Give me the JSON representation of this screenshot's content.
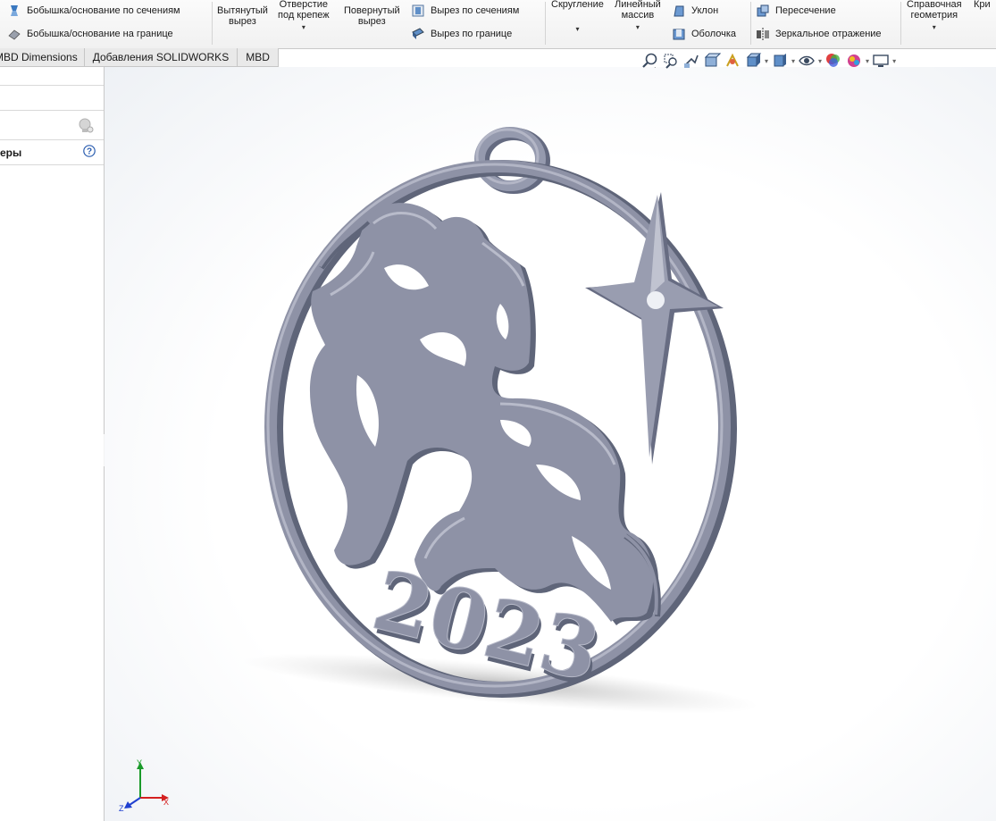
{
  "ribbon": {
    "boss_sections_label": "Бобышка/основание по сечениям",
    "boss_boundary_label": "Бобышка/основание на границе",
    "extruded_cut_label": "Вытянутый\nвырез",
    "hole_wizard_label": "Отверстие\nпод крепеж",
    "revolved_cut_label": "Повернутый\nвырез",
    "cut_sections_label": "Вырез по сечениям",
    "cut_boundary_label": "Вырез по границе",
    "fillet_label": "Скругление",
    "linear_pattern_label": "Линейный\nмассив",
    "draft_label": "Уклон",
    "shell_label": "Оболочка",
    "intersect_label": "Пересечение",
    "mirror_label": "Зеркальное отражение",
    "ref_geometry_label": "Справочная\nгеометрия",
    "curves_label": "Кри"
  },
  "tabs": [
    {
      "label": "MBD Dimensions"
    },
    {
      "label": "Добавления SOLIDWORKS"
    },
    {
      "label": "MBD"
    }
  ],
  "left_panel": {
    "section_label": "еры"
  },
  "model": {
    "year_text": "2023"
  },
  "triad": {
    "x_label": "X",
    "y_label": "Y",
    "z_label": "Z"
  },
  "colors": {
    "model": "#8e92a6",
    "model_dark": "#646a80",
    "model_light": "#b6b9c8",
    "axis_x": "#d42020",
    "axis_y": "#1a9a2a",
    "axis_z": "#2040d0"
  }
}
